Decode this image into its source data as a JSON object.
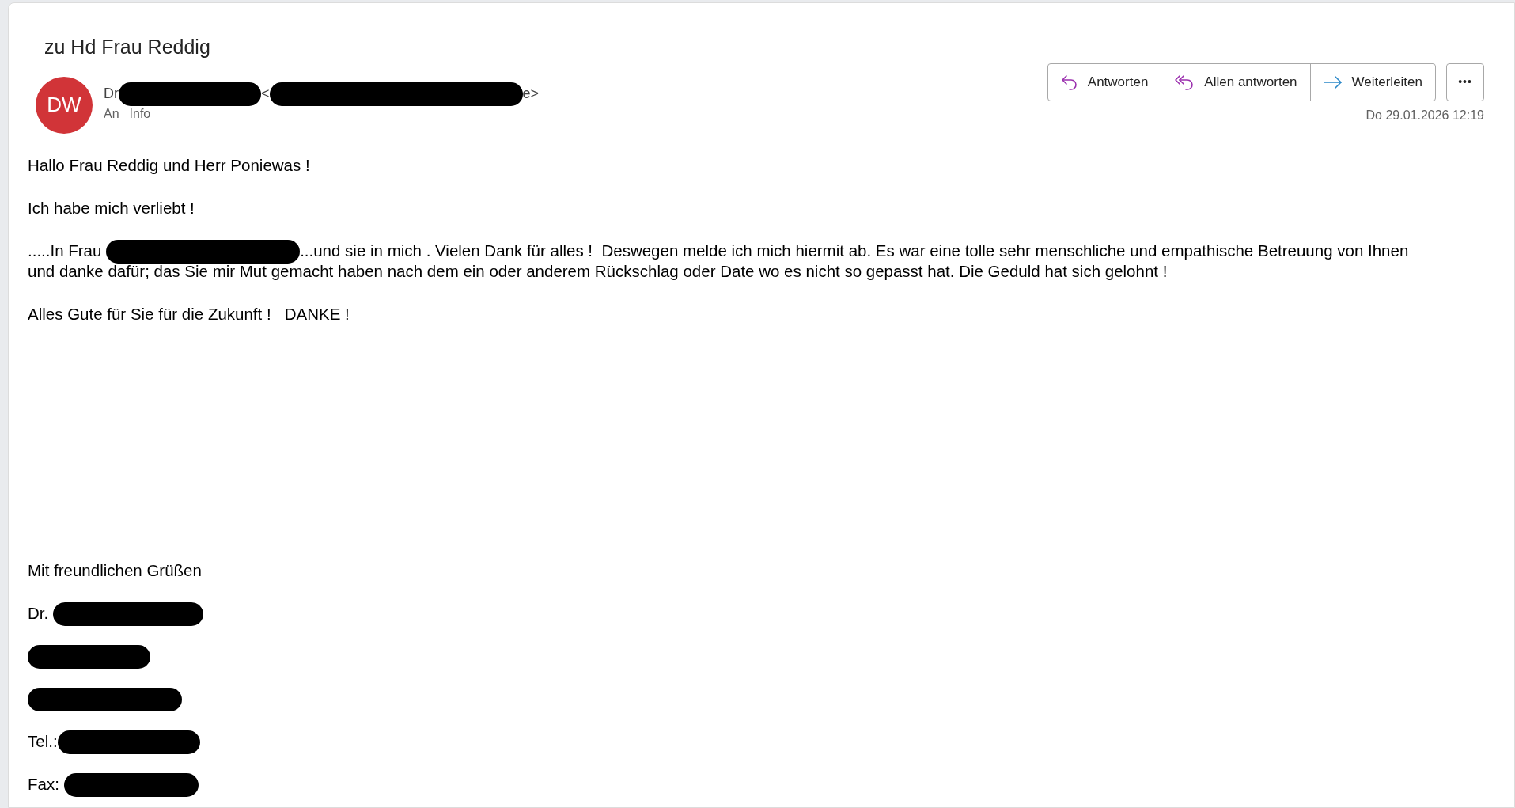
{
  "message": {
    "subject": "zu Hd Frau Reddig",
    "avatar": {
      "initials": "DW",
      "color": "#d13438"
    },
    "sender": [
      {
        "kind": "text",
        "text": "Dr"
      },
      {
        "kind": "redacted"
      },
      {
        "kind": "text",
        "text": "<"
      },
      {
        "kind": "redacted"
      },
      {
        "kind": "text",
        "text": "e>"
      }
    ],
    "recipients": {
      "label": "An",
      "value": "Info"
    },
    "actions": [
      {
        "kind": "reply",
        "label": "Antworten"
      },
      {
        "kind": "reply_all",
        "label": "Allen antworten"
      },
      {
        "kind": "forward",
        "label": "Weiterleiten"
      },
      {
        "kind": "more",
        "label": "•••"
      }
    ],
    "date": "Do 29.01.2026 12:19",
    "body": [
      {
        "lines": [
          [
            {
              "kind": "text",
              "text": "Hallo Frau Reddig und Herr Poniewas !"
            }
          ]
        ]
      },
      {
        "lines": [
          [
            {
              "kind": "text",
              "text": "Ich habe mich verliebt !"
            }
          ]
        ]
      },
      {
        "lines": [
          [
            {
              "kind": "text",
              "text": ".....In Frau "
            },
            {
              "kind": "redacted"
            },
            {
              "kind": "text",
              "text": "...und sie in mich . Vielen Dank für alles !  Deswegen melde ich mich hiermit ab. Es war eine tolle sehr menschliche und empathische Betreuung von Ihnen"
            }
          ],
          [
            {
              "kind": "text",
              "text": "und danke dafür; das Sie mir Mut gemacht haben nach dem ein oder anderem Rückschlag oder Date wo es nicht so gepasst hat. Die Geduld hat sich gelohnt !"
            }
          ]
        ]
      },
      {
        "lines": [
          [
            {
              "kind": "text",
              "text": "Alles Gute für Sie für die Zukunft !   DANKE !"
            }
          ]
        ]
      }
    ],
    "signature": [
      {
        "lines": [
          [
            {
              "kind": "text",
              "text": "Mit freundlichen Grüßen"
            }
          ]
        ]
      },
      {
        "lines": [
          [
            {
              "kind": "text",
              "text": "Dr. "
            },
            {
              "kind": "redacted"
            }
          ]
        ]
      },
      {
        "lines": [
          [
            {
              "kind": "redacted"
            }
          ]
        ]
      },
      {
        "lines": [
          [
            {
              "kind": "redacted"
            }
          ]
        ]
      },
      {
        "lines": [
          [
            {
              "kind": "text",
              "text": "Tel.:"
            },
            {
              "kind": "redacted"
            }
          ]
        ]
      },
      {
        "lines": [
          [
            {
              "kind": "text",
              "text": "Fax: "
            },
            {
              "kind": "redacted"
            }
          ]
        ]
      }
    ]
  }
}
